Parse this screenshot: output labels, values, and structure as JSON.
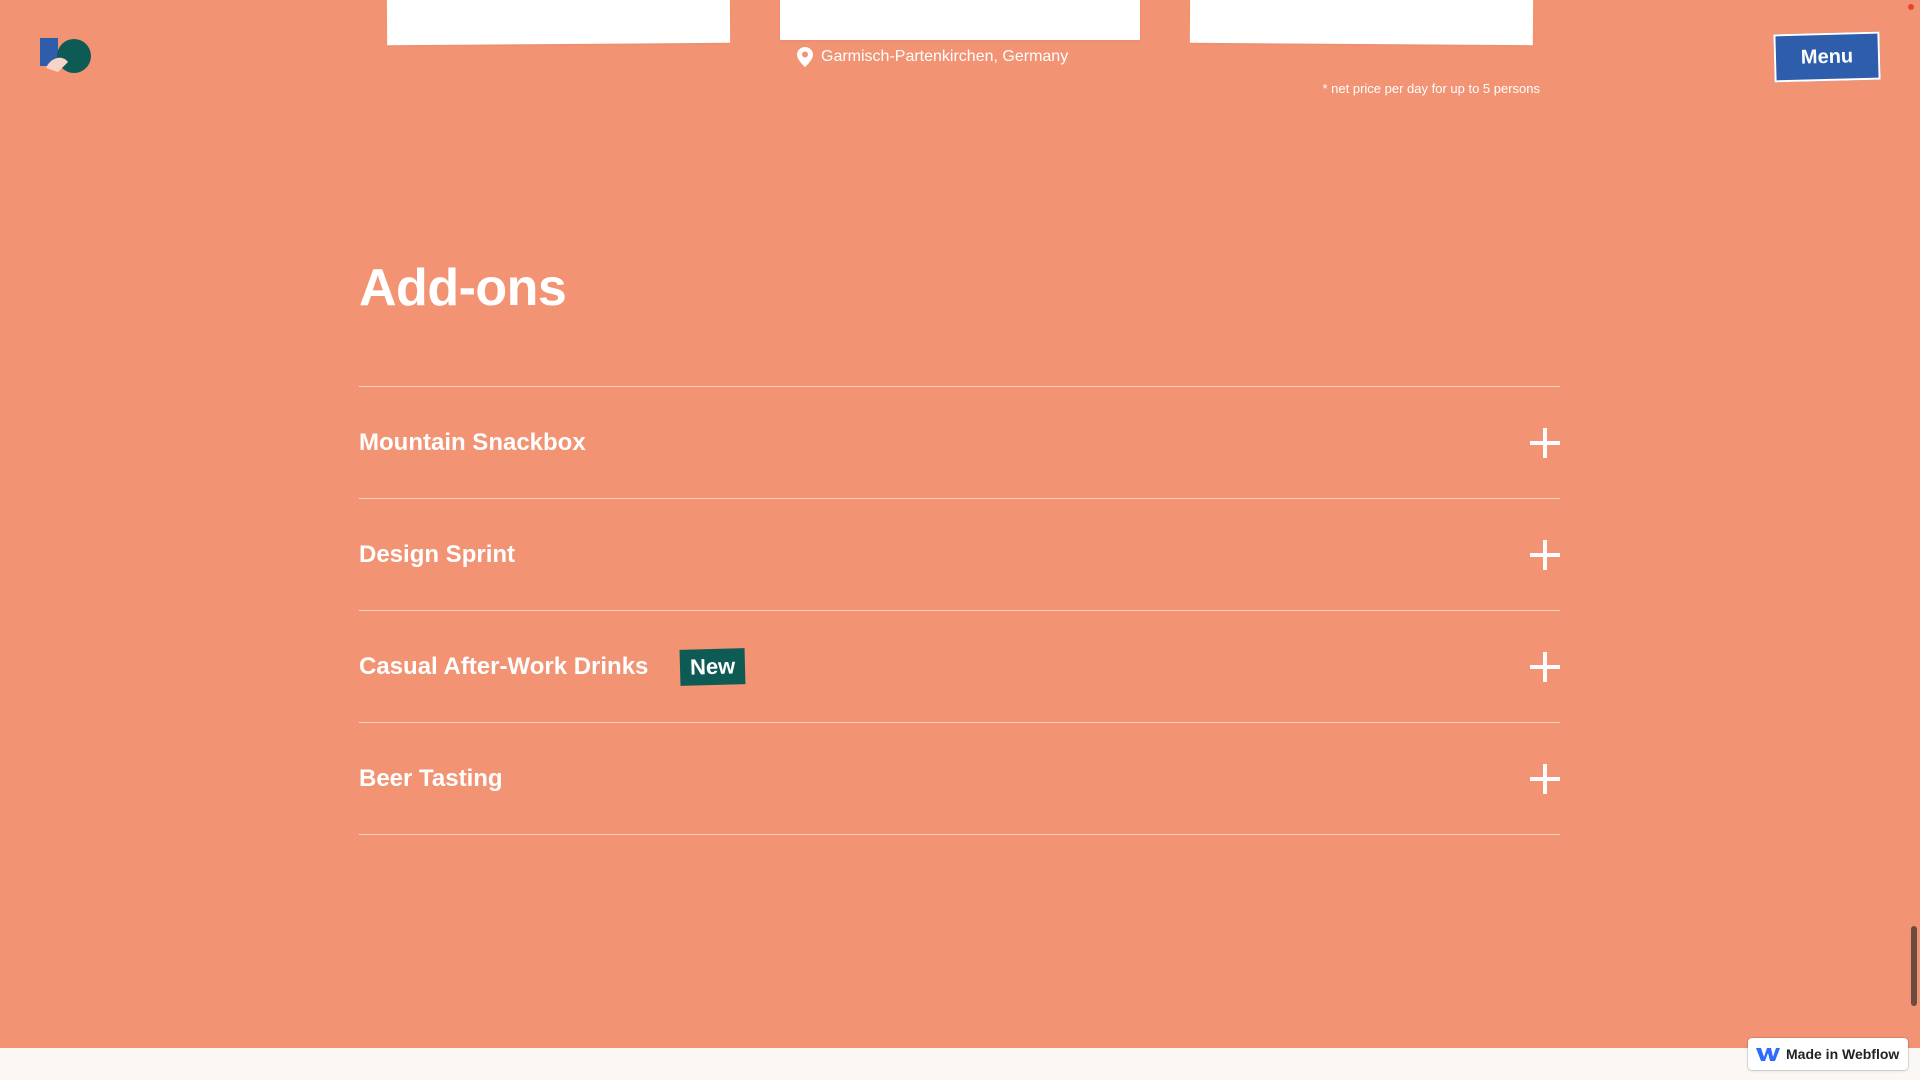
{
  "header": {
    "logo_name": "brand-logo",
    "menu_label": "Menu"
  },
  "venue": {
    "location": "Garmisch-Partenkirchen, Germany",
    "price_note": "* net price per day for up to 5 persons"
  },
  "addons": {
    "title": "Add-ons",
    "items": [
      {
        "label": "Mountain Snackbox",
        "badge": ""
      },
      {
        "label": "Design Sprint",
        "badge": ""
      },
      {
        "label": "Casual After-Work Drinks",
        "badge": "New"
      },
      {
        "label": "Beer Tasting",
        "badge": ""
      }
    ]
  },
  "footer": {
    "webflow_badge": "Made in Webflow"
  },
  "colors": {
    "page_background": "#f29373",
    "menu_button": "#2e5dab",
    "new_badge": "#0e5b55",
    "logo_blue": "#2e5dab",
    "logo_green": "#0e5b55"
  },
  "icons": [
    "brand-logo",
    "map-pin-icon",
    "plus-icon",
    "webflow-icon"
  ]
}
